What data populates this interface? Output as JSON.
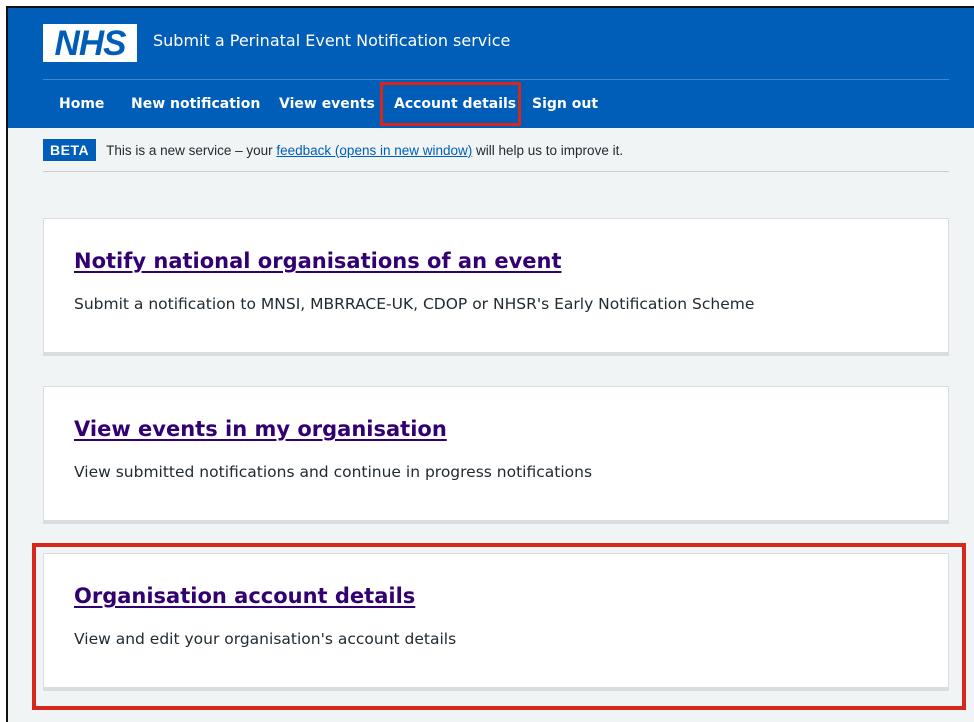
{
  "header": {
    "logo_text": "NHS",
    "service_name": "Submit a Perinatal Event Notification service",
    "brand_color": "#005eb8"
  },
  "nav": {
    "items": [
      {
        "label": "Home"
      },
      {
        "label": "New notification"
      },
      {
        "label": "View events"
      },
      {
        "label": "Account details"
      },
      {
        "label": "Sign out"
      }
    ],
    "highlighted": "Account details",
    "highlight_color": "#d5281b"
  },
  "beta_banner": {
    "tag": "BETA",
    "text_before": "This is a new service – your ",
    "link_text": "feedback (opens in new window)",
    "text_after": " will help us to improve it."
  },
  "cards": [
    {
      "title": "Notify national organisations of an event",
      "description": "Submit a notification to MNSI, MBRRACE-UK, CDOP or NHSR's Early Notification Scheme"
    },
    {
      "title": "View events in my organisation",
      "description": "View submitted notifications and continue in progress notifications"
    },
    {
      "title": "Organisation account details",
      "description": "View and edit your organisation's account details"
    }
  ],
  "colors": {
    "link_visited": "#330072",
    "text": "#212b32",
    "page_background": "#f0f4f5"
  }
}
